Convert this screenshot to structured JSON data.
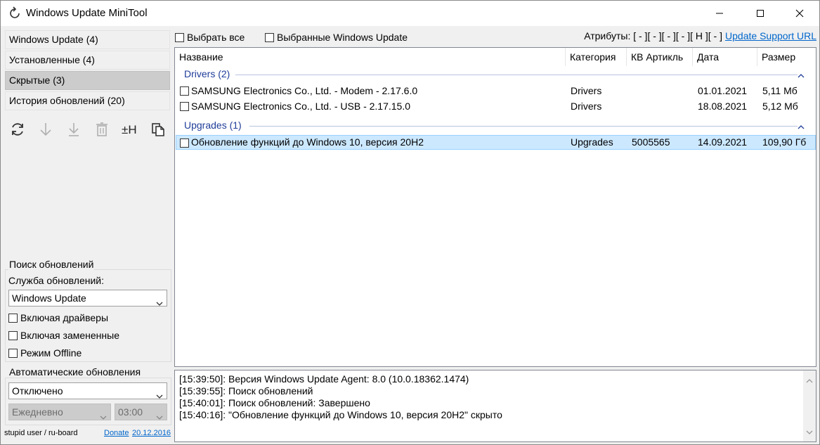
{
  "window": {
    "title": "Windows Update MiniTool"
  },
  "nav": [
    {
      "label": "Windows Update (4)",
      "selected": false
    },
    {
      "label": "Установленные (4)",
      "selected": false
    },
    {
      "label": "Скрытые (3)",
      "selected": true
    },
    {
      "label": "История обновлений (20)",
      "selected": false
    }
  ],
  "toolbar_icons": [
    "refresh-icon",
    "download-icon",
    "install-icon",
    "delete-icon",
    "hide-toggle-icon",
    "copy-icon"
  ],
  "search": {
    "legend": "Поиск обновлений",
    "service_label": "Служба обновлений:",
    "service_value": "Windows Update",
    "include_drivers": "Включая драйверы",
    "include_superseded": "Включая замененные",
    "offline_mode": "Режим Offline"
  },
  "auto": {
    "legend": "Автоматические обновления",
    "mode_value": "Отключено",
    "schedule_value": "Ежедневно",
    "time_value": "03:00"
  },
  "footer": {
    "credit": "stupid user / ru-board",
    "donate": "Donate",
    "date": "20.12.2016"
  },
  "topbar": {
    "select_all": "Выбрать все",
    "selected_wu": "Выбранные Windows Update",
    "attributes": "Атрибуты: [ - ][ - ][ - ][ - ][ H ][ - ]",
    "support_url": "Update Support URL"
  },
  "columns": {
    "name": "Название",
    "category": "Категория",
    "kb": "КВ Артикль",
    "date": "Дата",
    "size": "Размер"
  },
  "groups": [
    {
      "title": "Drivers (2)",
      "rows": [
        {
          "name": "SAMSUNG Electronics Co., Ltd.  - Modem - 2.17.6.0",
          "category": "Drivers",
          "kb": "",
          "date": "01.01.2021",
          "size": "5,11 Мб",
          "selected": false
        },
        {
          "name": "SAMSUNG Electronics Co., Ltd.  - USB - 2.17.15.0",
          "category": "Drivers",
          "kb": "",
          "date": "18.08.2021",
          "size": "5,12 Мб",
          "selected": false
        }
      ]
    },
    {
      "title": "Upgrades (1)",
      "rows": [
        {
          "name": "Обновление функций до Windows 10, версия 20H2",
          "category": "Upgrades",
          "kb": "5005565",
          "date": "14.09.2021",
          "size": "109,90 Гб",
          "selected": true
        }
      ]
    }
  ],
  "log": [
    "[15:39:50]: Версия Windows Update Agent: 8.0 (10.0.18362.1474)",
    "[15:39:55]: Поиск обновлений",
    "[15:40:01]: Поиск обновлений: Завершено",
    "[15:40:16]: \"Обновление функций до Windows 10, версия 20H2\" скрыто"
  ]
}
